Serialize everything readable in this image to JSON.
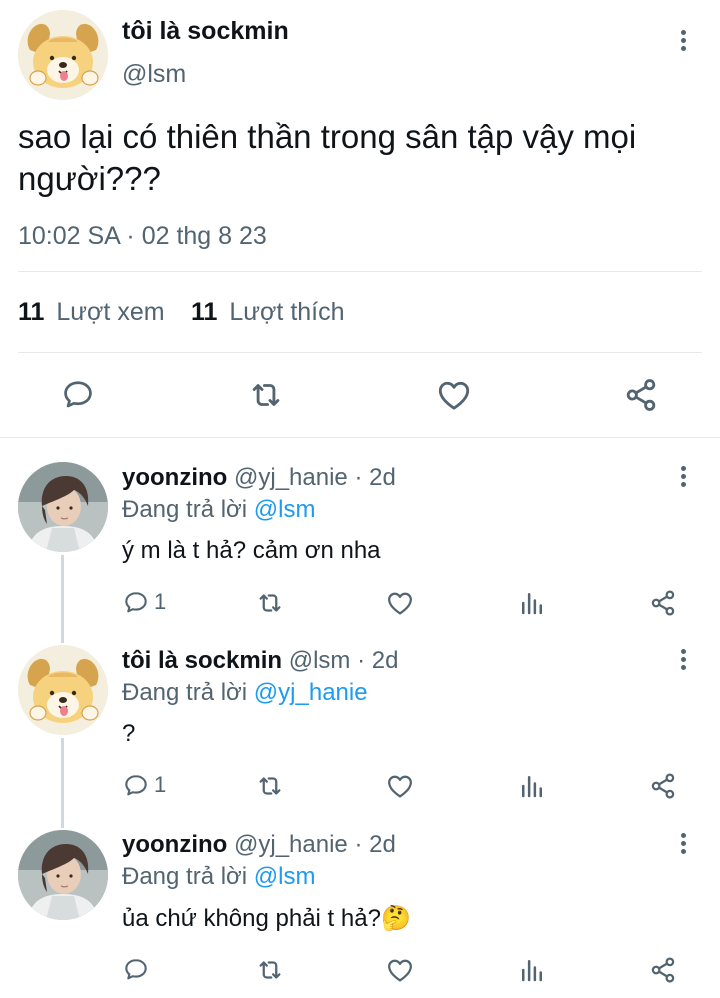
{
  "tweet": {
    "author_name": "tôi là sockmin",
    "author_handle": "@lsm",
    "text": "sao lại có thiên thần trong sân tập vậy mọi người???",
    "timestamp": "10:02 SA · 02 thg 8 23",
    "views_count": "11",
    "views_label": "Lượt xem",
    "likes_count": "11",
    "likes_label": "Lượt thích"
  },
  "replies": [
    {
      "author_name": "yoonzino",
      "author_handle": "@yj_hanie",
      "time": "· 2d",
      "replying_prefix": "Đang trả lời",
      "replying_to": "@lsm",
      "text": "ý m là t hả? cảm ơn nha",
      "reply_count": "1"
    },
    {
      "author_name": "tôi là sockmin",
      "author_handle": "@lsm",
      "time": "· 2d",
      "replying_prefix": "Đang trả lời",
      "replying_to": "@yj_hanie",
      "text": "?",
      "reply_count": "1"
    },
    {
      "author_name": "yoonzino",
      "author_handle": "@yj_hanie",
      "time": "· 2d",
      "replying_prefix": "Đang trả lời",
      "replying_to": "@lsm",
      "text": "ủa chứ không phải t hả?",
      "emoji": "🤔",
      "reply_count": ""
    }
  ],
  "icons": {
    "reply": "comment-icon",
    "retweet": "retweet-icon",
    "like": "heart-icon",
    "share": "share-icon",
    "analytics": "analytics-icon",
    "more": "more-vertical-icon"
  },
  "colors": {
    "text": "#0f1419",
    "secondary": "#536471",
    "link": "#1d9bf0",
    "divider": "#e7e9ea"
  }
}
